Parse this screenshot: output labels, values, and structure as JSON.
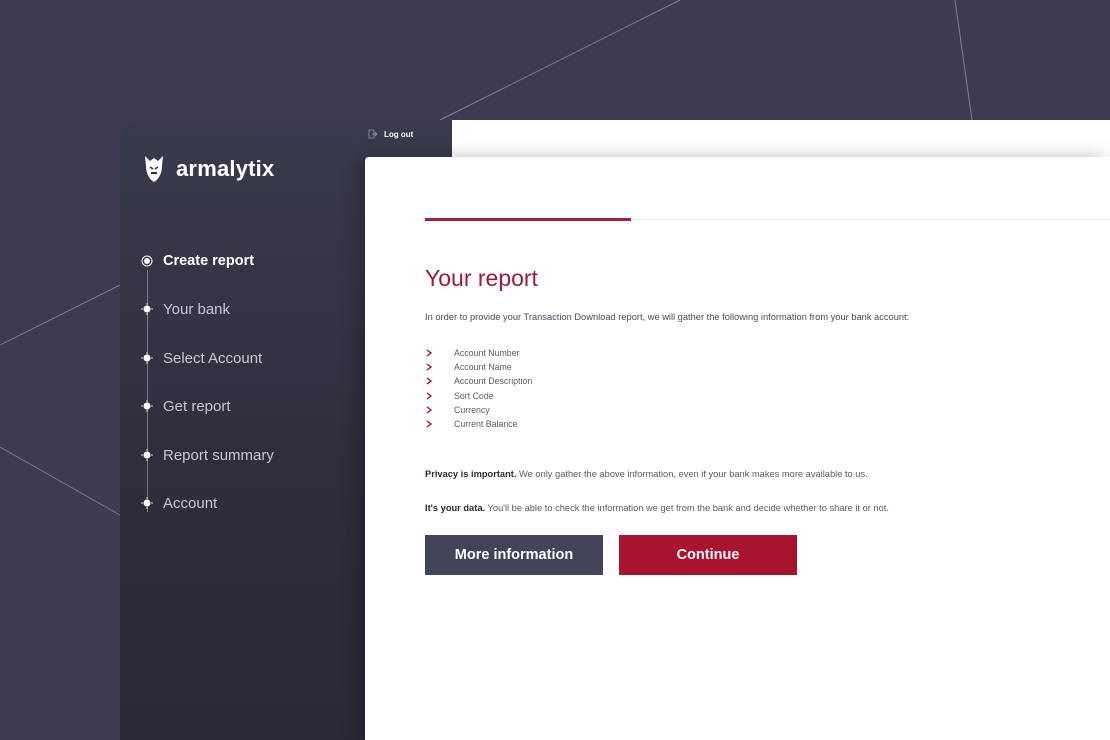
{
  "app": {
    "brand": "armalytix",
    "logout_label": "Log out"
  },
  "sidebar": {
    "steps": [
      {
        "label": "Create report",
        "active": true
      },
      {
        "label": "Your bank",
        "active": false
      },
      {
        "label": "Select Account",
        "active": false
      },
      {
        "label": "Get report",
        "active": false
      },
      {
        "label": "Report summary",
        "active": false
      },
      {
        "label": "Account",
        "active": false
      }
    ]
  },
  "main": {
    "progress": 0.3,
    "title": "Your report",
    "intro": "In order to provide your Transaction Download report, we will gather the following information from your bank account:",
    "items": [
      "Account Number",
      "Account Name",
      "Account Description",
      "Sort Code",
      "Currency",
      "Current Balance"
    ],
    "privacy_lead": "Privacy is important.",
    "privacy_text": " We only gather the above information, even if your bank makes more available to us.",
    "data_lead": "It's your data.",
    "data_text": " You'll be able to check the information we get from the bank and decide whether to share it or not.",
    "more_info_label": "More information",
    "continue_label": "Continue"
  },
  "colors": {
    "background": "#3d3a52",
    "accent": "#a8132f",
    "title": "#9b1c38",
    "secondary_button": "#43435a"
  },
  "icons": {
    "logo": "dragon-logo-icon",
    "logout": "logout-icon",
    "step_dot": "step-dot-icon",
    "list_marker": "chevron-right-icon"
  }
}
